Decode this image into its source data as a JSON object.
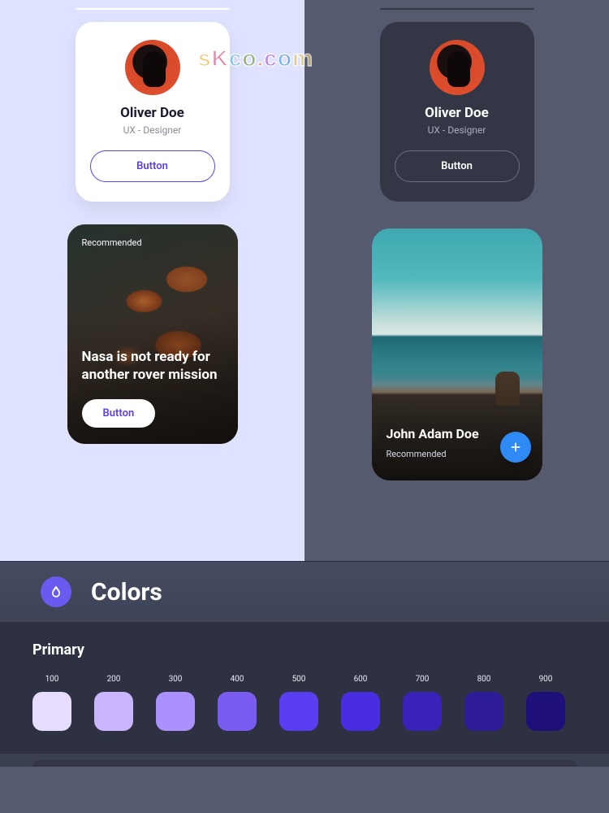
{
  "watermark": "sKco.com",
  "profile": {
    "name": "Oliver Doe",
    "role": "UX - Designer",
    "button_label": "Button"
  },
  "article": {
    "tag": "Recommended",
    "title": "Nasa is not ready for another rover mission",
    "button_label": "Button"
  },
  "ocean": {
    "name": "John Adam Doe",
    "tag": "Recommended"
  },
  "colors_section": {
    "title": "Colors",
    "palette_name": "Primary",
    "swatches": [
      {
        "label": "100",
        "hex": "#e6dcff"
      },
      {
        "label": "200",
        "hex": "#c9b6ff"
      },
      {
        "label": "300",
        "hex": "#ab90ff"
      },
      {
        "label": "400",
        "hex": "#7a5cf0"
      },
      {
        "label": "500",
        "hex": "#5a3df0"
      },
      {
        "label": "600",
        "hex": "#4a2ce0"
      },
      {
        "label": "700",
        "hex": "#3a22b8"
      },
      {
        "label": "800",
        "hex": "#2e1c96"
      },
      {
        "label": "900",
        "hex": "#1f0f78"
      }
    ]
  }
}
